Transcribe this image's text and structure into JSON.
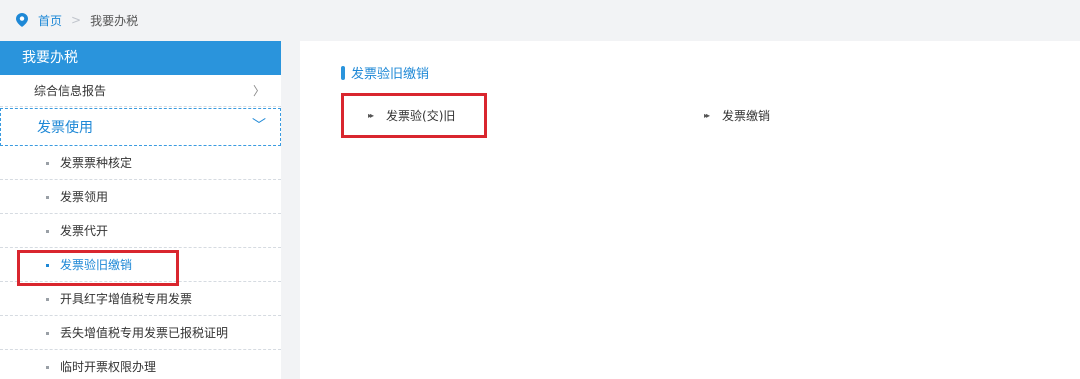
{
  "breadcrumb": {
    "home": "首页",
    "separator": ">",
    "current": "我要办税"
  },
  "sidebar": {
    "header": "我要办税",
    "items": [
      {
        "label": "综合信息报告",
        "chevron": "〉"
      }
    ],
    "group": {
      "label": "发票使用",
      "chevron": "﹀",
      "sub_items": [
        {
          "label": "发票票种核定"
        },
        {
          "label": "发票领用"
        },
        {
          "label": "发票代开"
        },
        {
          "label": "发票验旧缴销"
        },
        {
          "label": "开具红字增值税专用发票"
        },
        {
          "label": "丢失增值税专用发票已报税证明"
        },
        {
          "label": "临时开票权限办理"
        }
      ]
    }
  },
  "main": {
    "section_title": "发票验旧缴销",
    "links": [
      {
        "label": "发票验(交)旧",
        "arrow": "▸▸"
      },
      {
        "label": "发票缴销",
        "arrow": "▸▸"
      }
    ]
  },
  "colors": {
    "accent": "#1e88d6",
    "header_bg": "#2a94dc",
    "highlight": "#d9262e"
  }
}
